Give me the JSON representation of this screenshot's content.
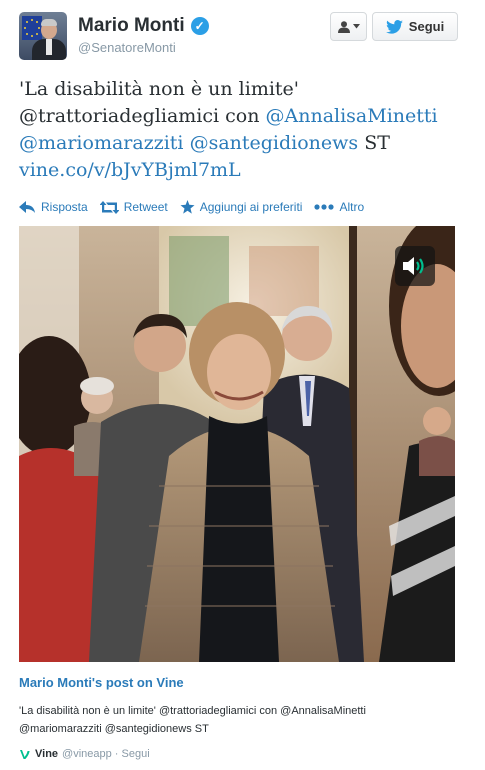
{
  "author": {
    "name": "Mario Monti",
    "handle": "@SenatoreMonti"
  },
  "buttons": {
    "follow_label": "Segui"
  },
  "tweet": {
    "text_part1": "'La disabilità non è un limite'",
    "text_part2": "@trattoriadegliamici con ",
    "mention_annalisa": "@AnnalisaMinetti",
    "mention_marazzitti": "@mariomarazziti",
    "mention_santegidio": "@santegidionews",
    "text_st": "ST",
    "link": "vine.co/v/bJvYBjml7mL"
  },
  "actions": {
    "reply": "Risposta",
    "retweet": "Retweet",
    "favorite": "Aggiungi ai preferiti",
    "more": "Altro"
  },
  "card": {
    "title": "Mario Monti's post on Vine",
    "desc_line1": "'La disabilità non è un limite' @trattoriadegliamici con @AnnalisaMinetti",
    "desc_line2": "@mariomarazziti @santegidionews ST",
    "vine_name": "Vine",
    "vine_handle": "@vineapp · Segui"
  },
  "colors": {
    "link": "#2b7bb9",
    "verified": "#2b9fe6",
    "muted": "#8899a6",
    "vine_green": "#00bf8f"
  }
}
